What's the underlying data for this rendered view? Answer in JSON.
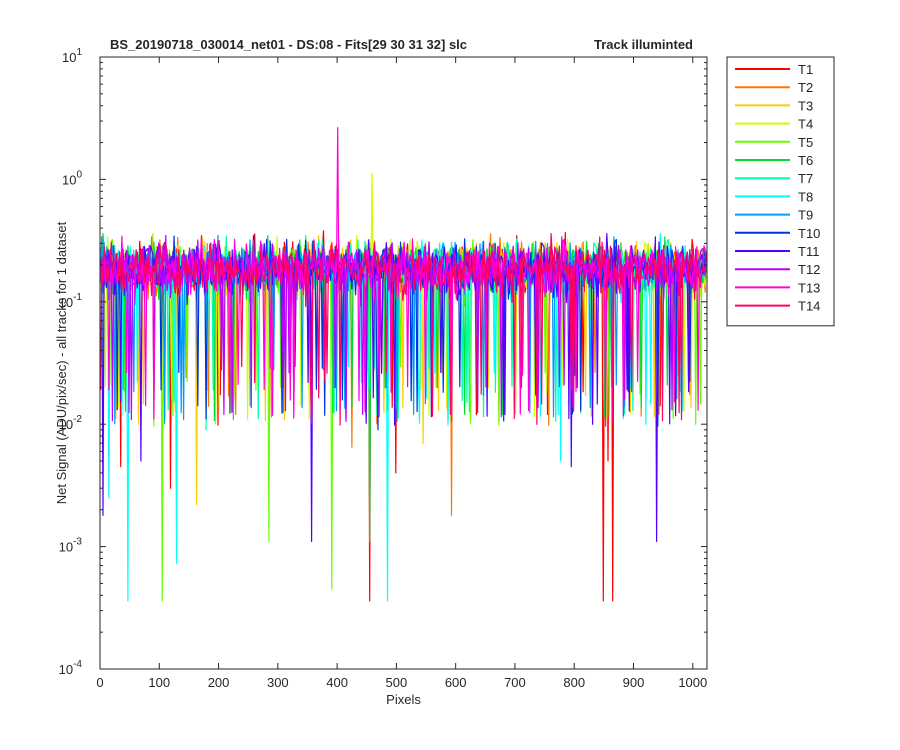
{
  "chart_data": {
    "type": "line",
    "title_left": "BS_20190718_030014_net01 - DS:08 - Fits[29  30  31  32]   slc",
    "title_right": "Track illuminted",
    "xlabel": "Pixels",
    "ylabel": "Net Signal (ADU/pix/sec) - all tracks for 1 dataset",
    "xlim": [
      0,
      1024
    ],
    "ylim": [
      0.0001,
      10
    ],
    "yscale": "log",
    "grid": false,
    "legend_position": "outside-top-right",
    "x_ticks": [
      "0",
      "100",
      "200",
      "300",
      "400",
      "500",
      "600",
      "700",
      "800",
      "900",
      "1000"
    ],
    "y_ticks": [
      {
        "base": "10",
        "exp": "-4"
      },
      {
        "base": "10",
        "exp": "-3"
      },
      {
        "base": "10",
        "exp": "-2"
      },
      {
        "base": "10",
        "exp": "-1"
      },
      {
        "base": "10",
        "exp": "0"
      },
      {
        "base": "10",
        "exp": "1"
      }
    ],
    "x_range": [
      1,
      1024
    ],
    "typical_range": [
      0.03,
      0.5
    ],
    "median_level": 0.19,
    "series": [
      {
        "name": "T1",
        "color": "#ff0000",
        "dips": [
          [
            455,
            0.00036
          ],
          [
            850,
            0.00036
          ],
          [
            858,
            0.005
          ],
          [
            755,
            0.012
          ],
          [
            500,
            0.004
          ],
          [
            35,
            0.0045
          ],
          [
            865,
            0.00036
          ],
          [
            120,
            0.003
          ]
        ]
      },
      {
        "name": "T2",
        "color": "#ff7700",
        "dips": [
          [
            593,
            0.0018
          ],
          [
            425,
            0.0065
          ],
          [
            230,
            0.012
          ]
        ]
      },
      {
        "name": "T3",
        "color": "#ffcc00",
        "dips": [
          [
            163,
            0.0022
          ],
          [
            545,
            0.007
          ]
        ]
      },
      {
        "name": "T4",
        "color": "#ccff00",
        "dips": [
          [
            105,
            0.0028
          ],
          [
            250,
            0.011
          ]
        ],
        "peaks": [
          [
            460,
            1.12
          ]
        ]
      },
      {
        "name": "T5",
        "color": "#66ff00",
        "dips": [
          [
            105,
            0.00036
          ],
          [
            392,
            0.00045
          ],
          [
            285,
            0.0011
          ],
          [
            305,
            0.02
          ]
        ]
      },
      {
        "name": "T6",
        "color": "#00dd33",
        "dips": [
          [
            455,
            0.0011
          ],
          [
            680,
            0.012
          ]
        ]
      },
      {
        "name": "T7",
        "color": "#00ffaa",
        "dips": [
          [
            180,
            0.009
          ],
          [
            620,
            0.015
          ]
        ]
      },
      {
        "name": "T8",
        "color": "#00ffff",
        "dips": [
          [
            48,
            0.00036
          ],
          [
            130,
            0.00073
          ],
          [
            485,
            0.00036
          ],
          [
            777,
            0.005
          ],
          [
            15,
            0.0025
          ]
        ]
      },
      {
        "name": "T9",
        "color": "#0099ff",
        "dips": [
          [
            700,
            0.014
          ]
        ]
      },
      {
        "name": "T10",
        "color": "#0033dd",
        "dips": [
          [
            470,
            0.009
          ]
        ]
      },
      {
        "name": "T11",
        "color": "#5500ff",
        "dips": [
          [
            357,
            0.0011
          ],
          [
            795,
            0.0045
          ],
          [
            940,
            0.0011
          ],
          [
            5,
            0.0018
          ],
          [
            70,
            0.005
          ]
        ]
      },
      {
        "name": "T12",
        "color": "#bb00ff",
        "dips": [
          [
            210,
            0.012
          ]
        ]
      },
      {
        "name": "T13",
        "color": "#ff00dd",
        "dips": [
          [
            1010,
            0.013
          ]
        ],
        "peaks": [
          [
            401,
            2.65
          ]
        ]
      },
      {
        "name": "T14",
        "color": "#ff0066",
        "dips": []
      }
    ]
  }
}
